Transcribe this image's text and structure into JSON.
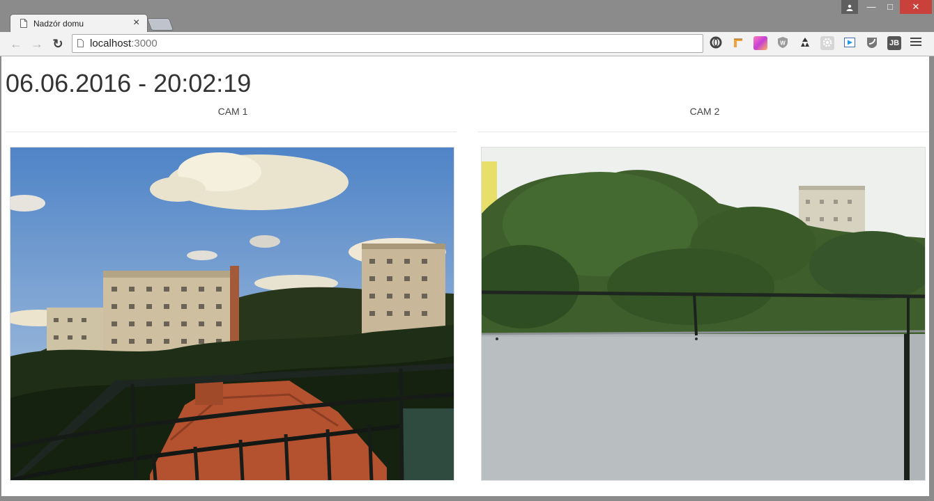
{
  "browser": {
    "tab_title": "Nadzór domu",
    "tab_close": "×",
    "url_host": "localhost",
    "url_port": ":3000",
    "window_buttons": {
      "minimize": "—",
      "maximize": "□",
      "close": "✕"
    },
    "extension_labels": {
      "jb": "JB"
    }
  },
  "page": {
    "datetime": "06.06.2016 - 20:02:19",
    "cameras": [
      {
        "label": "CAM 1"
      },
      {
        "label": "CAM 2"
      }
    ]
  }
}
